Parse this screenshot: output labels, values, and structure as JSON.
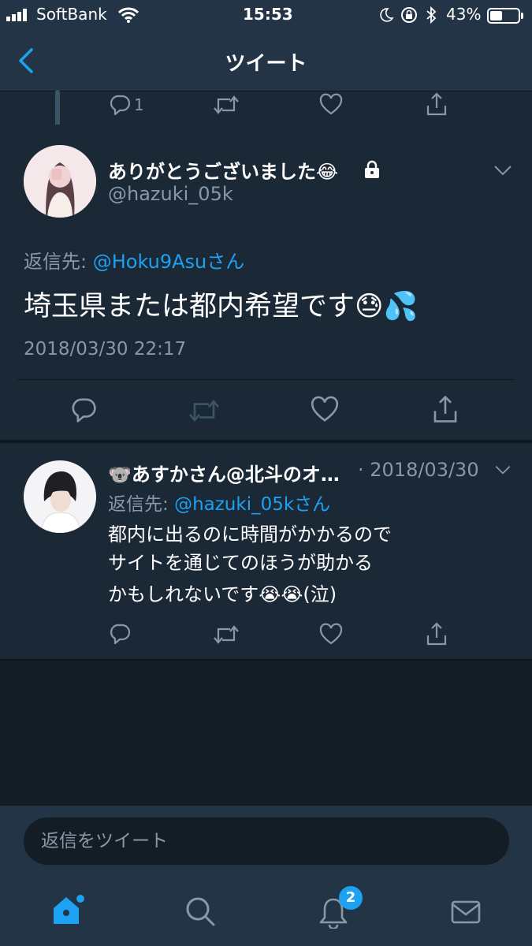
{
  "status_bar": {
    "carrier": "SoftBank",
    "time": "15:53",
    "battery": "43%",
    "battery_level": 0.43
  },
  "nav": {
    "title": "ツイート"
  },
  "prev_tweet": {
    "reply_count": "1"
  },
  "main_tweet": {
    "name": "ありがとうございました",
    "name_emoji": "😂",
    "handle": "@hazuki_05k",
    "reply_to_label": "返信先:",
    "reply_to": "@Hoku9Asuさん",
    "text": "埼玉県または都内希望です",
    "text_emoji": "😓💦",
    "timestamp": "2018/03/30 22:17"
  },
  "reply_tweet": {
    "name_emoji": "🐨",
    "name": "あすかさん@北斗のオ…",
    "date": "· 2018/03/30",
    "reply_to_label": "返信先:",
    "reply_to": "@hazuki_05kさん",
    "line1": "都内に出るのに時間がかかるので",
    "line2": "サイトを通じてのほうが助かる",
    "line3": "かもしれないです",
    "line3_emoji": "😭😭",
    "line3_suffix": "(泣)"
  },
  "compose": {
    "placeholder": "返信をツイート"
  },
  "tab_bar": {
    "notification_count": "2"
  },
  "colors": {
    "accent": "#1da1f2",
    "background": "#141d26",
    "card": "#1b2836",
    "bar": "#243447",
    "muted": "#8899a6"
  }
}
